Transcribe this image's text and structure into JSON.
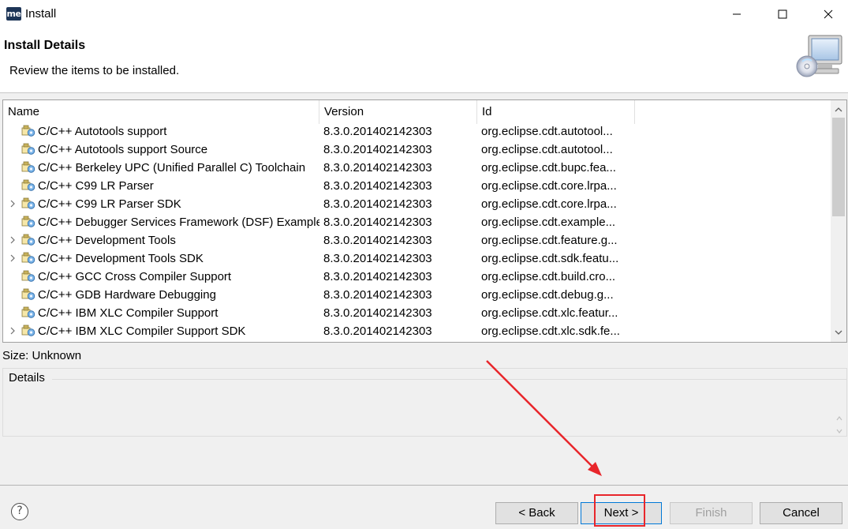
{
  "window": {
    "app_icon_text": "me",
    "title": "Install"
  },
  "header": {
    "title": "Install Details",
    "description": "Review the items to be installed."
  },
  "tree": {
    "columns": {
      "name": "Name",
      "version": "Version",
      "id": "Id"
    },
    "rows": [
      {
        "name": "C/C++ Autotools support",
        "version": "8.3.0.201402142303",
        "id": "org.eclipse.cdt.autotool...",
        "expandable": false
      },
      {
        "name": "C/C++ Autotools support Source",
        "version": "8.3.0.201402142303",
        "id": "org.eclipse.cdt.autotool...",
        "expandable": false
      },
      {
        "name": "C/C++ Berkeley UPC (Unified Parallel C) Toolchain",
        "version": "8.3.0.201402142303",
        "id": "org.eclipse.cdt.bupc.fea...",
        "expandable": false
      },
      {
        "name": "C/C++ C99 LR Parser",
        "version": "8.3.0.201402142303",
        "id": "org.eclipse.cdt.core.lrpa...",
        "expandable": false
      },
      {
        "name": "C/C++ C99 LR Parser SDK",
        "version": "8.3.0.201402142303",
        "id": "org.eclipse.cdt.core.lrpa...",
        "expandable": true
      },
      {
        "name": "C/C++ Debugger Services Framework (DSF) Examples",
        "version": "8.3.0.201402142303",
        "id": "org.eclipse.cdt.example...",
        "expandable": false
      },
      {
        "name": "C/C++ Development Tools",
        "version": "8.3.0.201402142303",
        "id": "org.eclipse.cdt.feature.g...",
        "expandable": true
      },
      {
        "name": "C/C++ Development Tools SDK",
        "version": "8.3.0.201402142303",
        "id": "org.eclipse.cdt.sdk.featu...",
        "expandable": true
      },
      {
        "name": "C/C++ GCC Cross Compiler Support",
        "version": "8.3.0.201402142303",
        "id": "org.eclipse.cdt.build.cro...",
        "expandable": false
      },
      {
        "name": "C/C++ GDB Hardware Debugging",
        "version": "8.3.0.201402142303",
        "id": "org.eclipse.cdt.debug.g...",
        "expandable": false
      },
      {
        "name": "C/C++ IBM XLC Compiler Support",
        "version": "8.3.0.201402142303",
        "id": "org.eclipse.cdt.xlc.featur...",
        "expandable": false
      },
      {
        "name": "C/C++ IBM XLC Compiler Support SDK",
        "version": "8.3.0.201402142303",
        "id": "org.eclipse.cdt.xlc.sdk.fe...",
        "expandable": true
      }
    ]
  },
  "size_label": "Size: Unknown",
  "details": {
    "label": "Details"
  },
  "buttons": {
    "help": "?",
    "back": "< Back",
    "next": "Next >",
    "finish": "Finish",
    "cancel": "Cancel"
  },
  "colors": {
    "annotation": "#e8262b",
    "focus_border": "#0078d7"
  },
  "icons": {
    "feature": "feature-plugin-icon",
    "expand": "chevron-right-icon",
    "banner": "install-monitor-cd-icon"
  }
}
